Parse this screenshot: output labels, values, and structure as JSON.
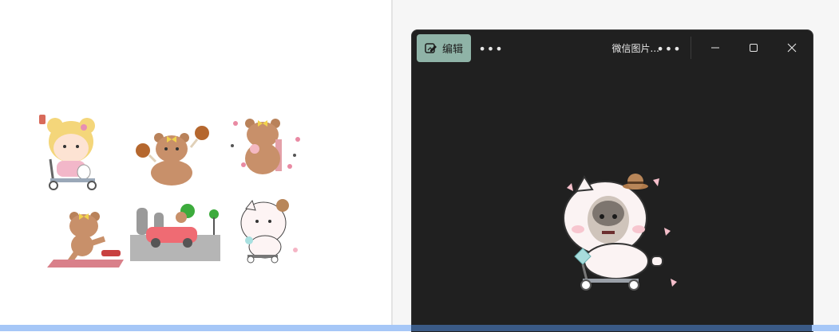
{
  "viewer": {
    "edit_label": "编辑",
    "more_label": "•••",
    "file_name": "微信图片...",
    "more2_label": "•••"
  },
  "icons": {
    "edit": "edit-image-icon",
    "minimize": "minimize-icon",
    "maximize": "maximize-icon",
    "close": "close-icon"
  },
  "colors": {
    "viewer_bg": "#202020",
    "edit_button": "#8fb3a7",
    "taskbar": "#a6c7f7"
  }
}
